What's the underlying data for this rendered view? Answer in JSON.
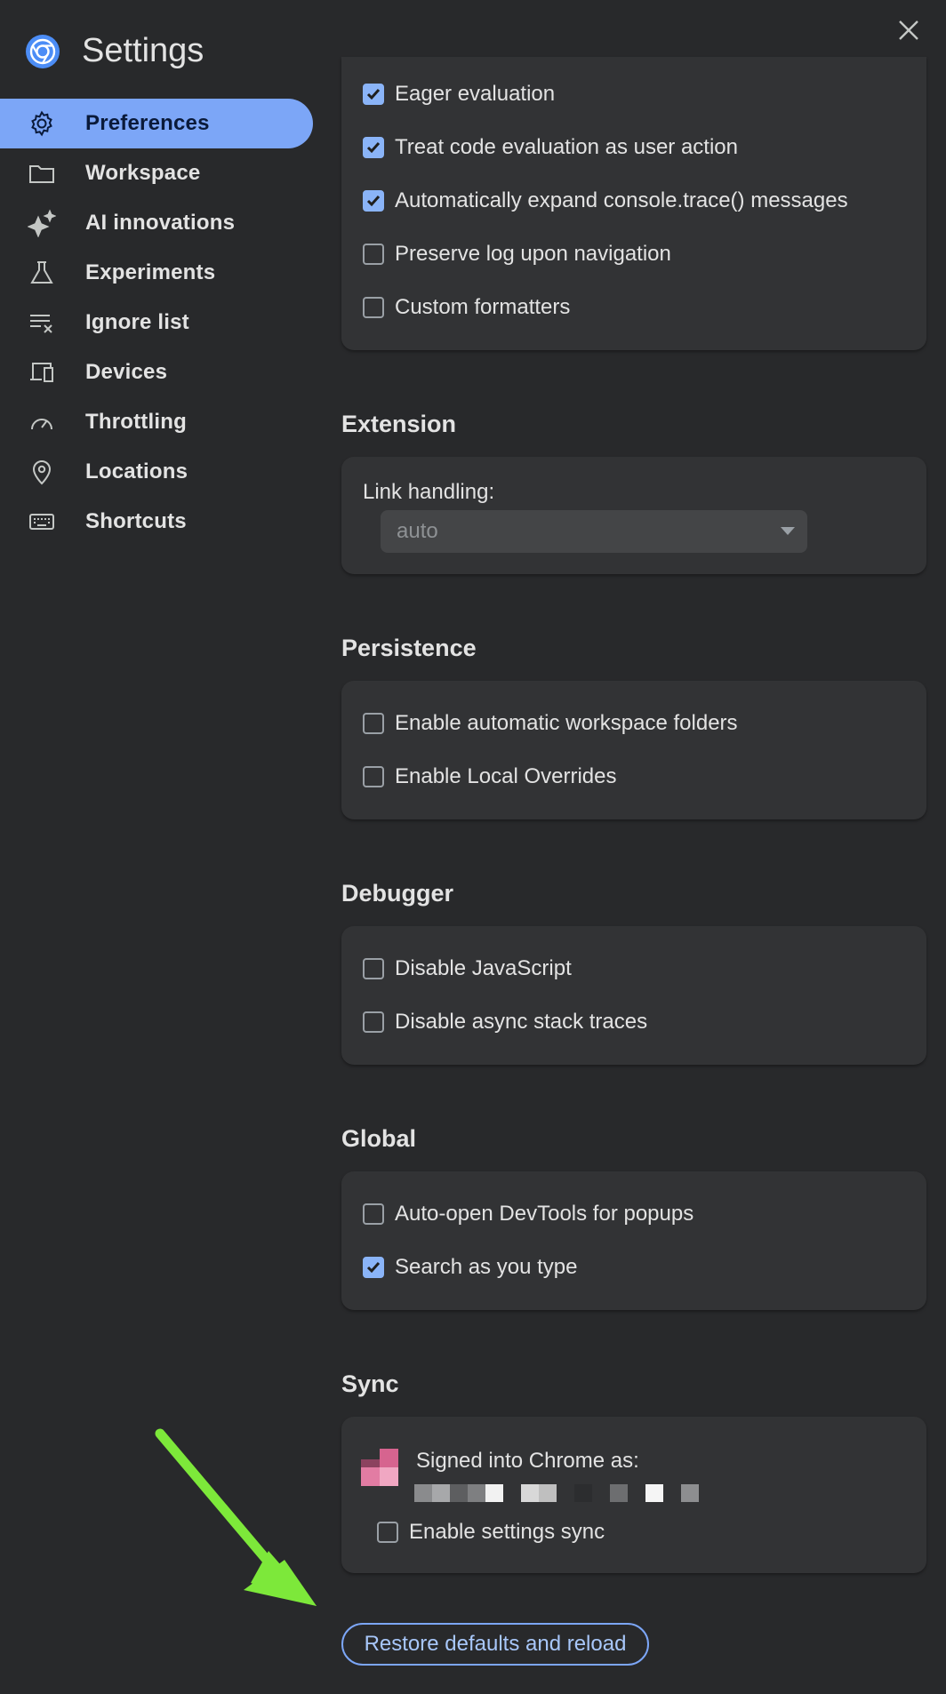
{
  "header": {
    "title": "Settings"
  },
  "sidebar": {
    "items": [
      {
        "label": "Preferences",
        "icon": "gear-icon",
        "active": true
      },
      {
        "label": "Workspace",
        "icon": "folder-icon",
        "active": false
      },
      {
        "label": "AI innovations",
        "icon": "sparkle-icon",
        "active": false
      },
      {
        "label": "Experiments",
        "icon": "flask-icon",
        "active": false
      },
      {
        "label": "Ignore list",
        "icon": "ignore-list-icon",
        "active": false
      },
      {
        "label": "Devices",
        "icon": "devices-icon",
        "active": false
      },
      {
        "label": "Throttling",
        "icon": "speedometer-icon",
        "active": false
      },
      {
        "label": "Locations",
        "icon": "location-pin-icon",
        "active": false
      },
      {
        "label": "Shortcuts",
        "icon": "keyboard-icon",
        "active": false
      }
    ]
  },
  "console": {
    "options": [
      {
        "label": "Eager evaluation",
        "checked": true
      },
      {
        "label": "Treat code evaluation as user action",
        "checked": true
      },
      {
        "label": "Automatically expand console.trace() messages",
        "checked": true
      },
      {
        "label": "Preserve log upon navigation",
        "checked": false
      },
      {
        "label": "Custom formatters",
        "checked": false
      }
    ]
  },
  "extension": {
    "title": "Extension",
    "link_handling_label": "Link handling:",
    "link_handling_value": "auto"
  },
  "persistence": {
    "title": "Persistence",
    "options": [
      {
        "label": "Enable automatic workspace folders",
        "checked": false
      },
      {
        "label": "Enable Local Overrides",
        "checked": false
      }
    ]
  },
  "debugger": {
    "title": "Debugger",
    "options": [
      {
        "label": "Disable JavaScript",
        "checked": false
      },
      {
        "label": "Disable async stack traces",
        "checked": false
      }
    ]
  },
  "global": {
    "title": "Global",
    "options": [
      {
        "label": "Auto-open DevTools for popups",
        "checked": false
      },
      {
        "label": "Search as you type",
        "checked": true
      }
    ]
  },
  "sync": {
    "title": "Sync",
    "signed_in_label": "Signed into Chrome as:",
    "enable_sync_label": "Enable settings sync",
    "enable_sync_checked": false
  },
  "footer": {
    "restore_label": "Restore defaults and reload"
  },
  "colors": {
    "background": "#28292b",
    "card": "#323335",
    "accent": "#7ca6f7",
    "checkbox_on": "#8ab4f8",
    "annotation_arrow": "#7de83a"
  }
}
